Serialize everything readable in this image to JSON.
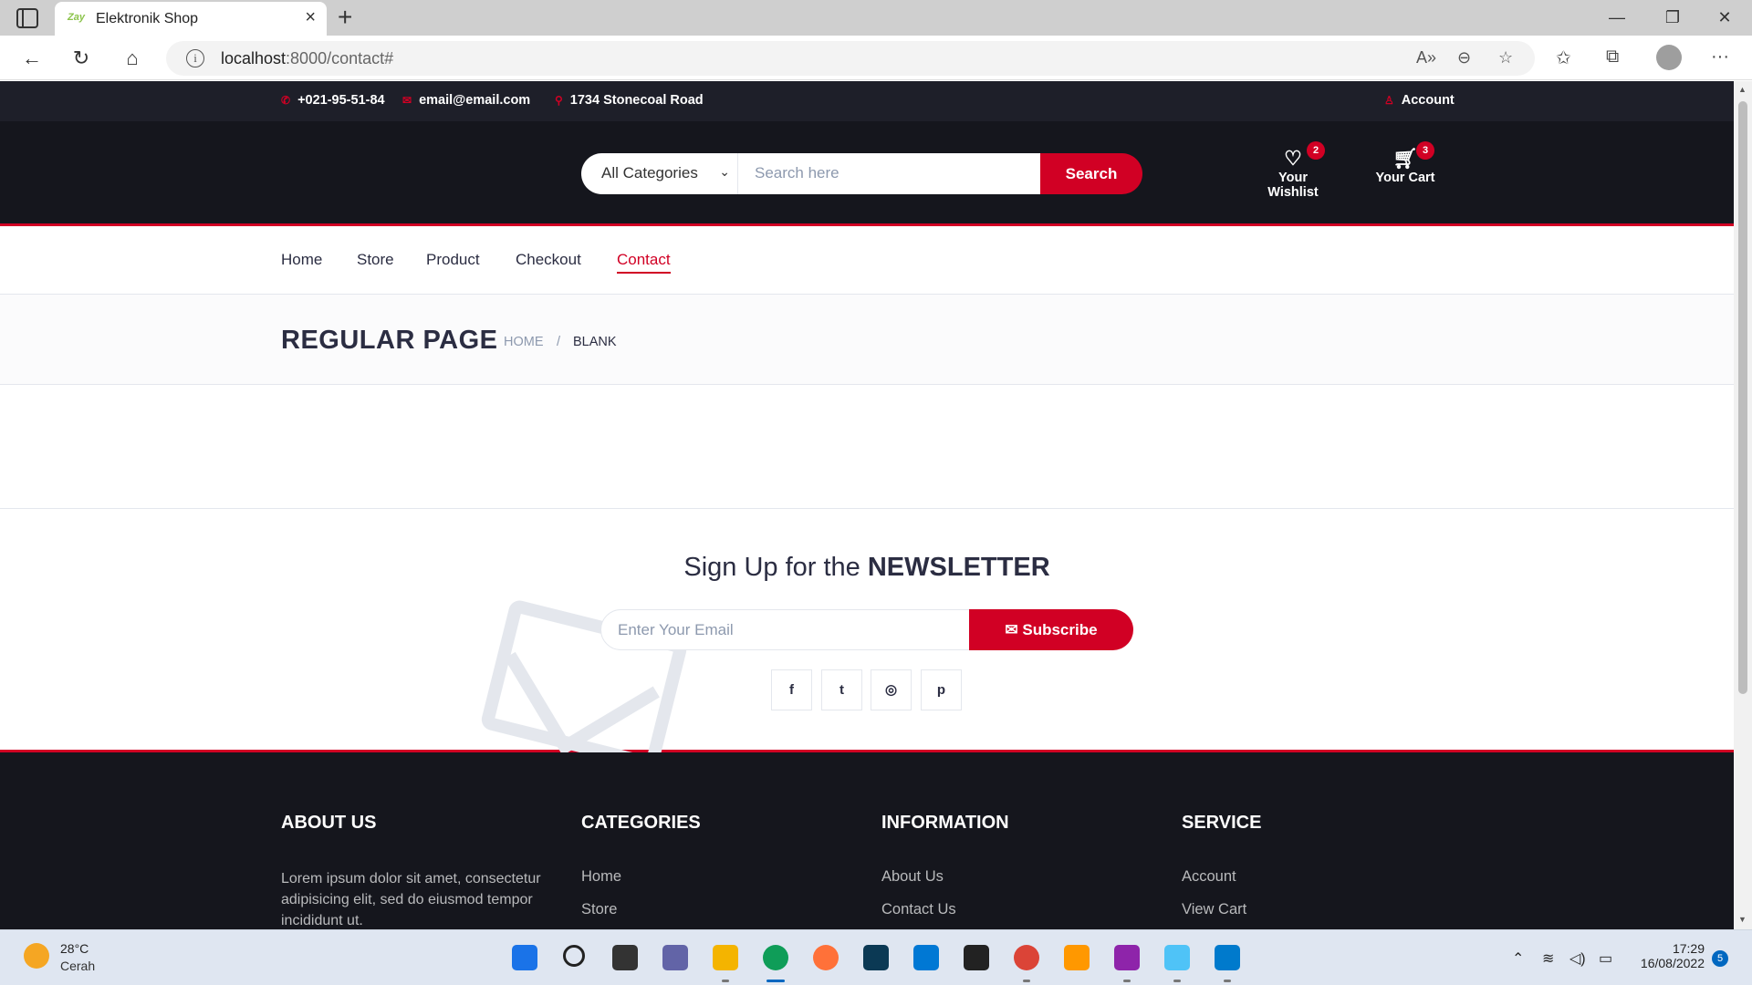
{
  "browser": {
    "tab_title": "Elektronik Shop",
    "tab_favicon": "Zay",
    "url_host": "localhost",
    "url_rest": ":8000/contact#",
    "icons": [
      "tab-actions-icon",
      "close-icon",
      "new-tab-icon",
      "minimize-icon",
      "restore-icon",
      "window-close-icon",
      "back-icon",
      "refresh-icon",
      "home-icon",
      "info-icon",
      "read-aloud-icon",
      "zoom-out-icon",
      "add-favorite-icon",
      "favorites-icon",
      "collections-icon",
      "profile-icon",
      "more-icon"
    ]
  },
  "topbar": {
    "phone": "+021-95-51-84",
    "email": "email@email.com",
    "address": "1734 Stonecoal Road",
    "account": "Account"
  },
  "header": {
    "category_select": "All Categories",
    "search_placeholder": "Search here",
    "search_button": "Search",
    "wishlist_label": "Your Wishlist",
    "wishlist_count": "2",
    "cart_label": "Your Cart",
    "cart_count": "3"
  },
  "nav": {
    "items": [
      "Home",
      "Store",
      "Product",
      "Checkout",
      "Contact"
    ],
    "active": "Contact"
  },
  "breadcrumb": {
    "title": "REGULAR PAGE",
    "home": "HOME",
    "separator": "/",
    "current": "BLANK"
  },
  "newsletter": {
    "title_prefix": "Sign Up for the ",
    "title_bold": "NEWSLETTER",
    "email_placeholder": "Enter Your Email",
    "subscribe": "Subscribe",
    "social": [
      "f",
      "t",
      "◎",
      "p"
    ]
  },
  "footer": {
    "about_title": "ABOUT US",
    "about_text": "Lorem ipsum dolor sit amet, consectetur adipisicing elit, sed do eiusmod tempor incididunt ut.",
    "categories_title": "CATEGORIES",
    "categories": [
      "Home",
      "Store"
    ],
    "information_title": "INFORMATION",
    "information": [
      "About Us",
      "Contact Us"
    ],
    "service_title": "SERVICE",
    "service": [
      "Account",
      "View Cart"
    ]
  },
  "taskbar": {
    "temperature": "28°C",
    "weather": "Cerah",
    "time": "17:29",
    "date": "16/08/2022",
    "notifications": "5"
  },
  "colors": {
    "accent": "#d10024",
    "dark": "#15161d",
    "topbar": "#1e1f29"
  }
}
